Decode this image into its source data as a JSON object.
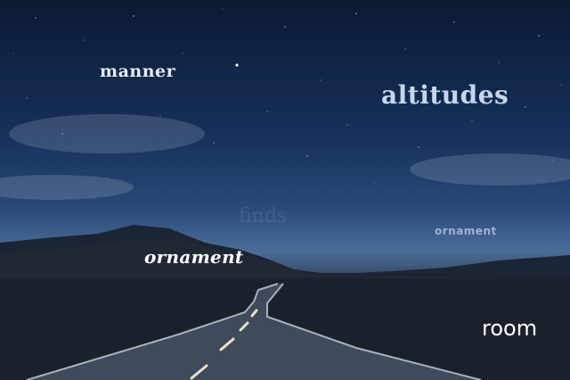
{
  "scene": {
    "description_words": {
      "manner": "manner",
      "altitudes": "altitudes",
      "ornament_script": "ornament",
      "ornament_small": "ornament",
      "faint": "finds",
      "room": "room"
    },
    "colors": {
      "sky_top": "#0c1a33",
      "sky_horizon": "#4a6d98",
      "ground": "#161d26",
      "road_line": "#e8e2c8"
    }
  }
}
